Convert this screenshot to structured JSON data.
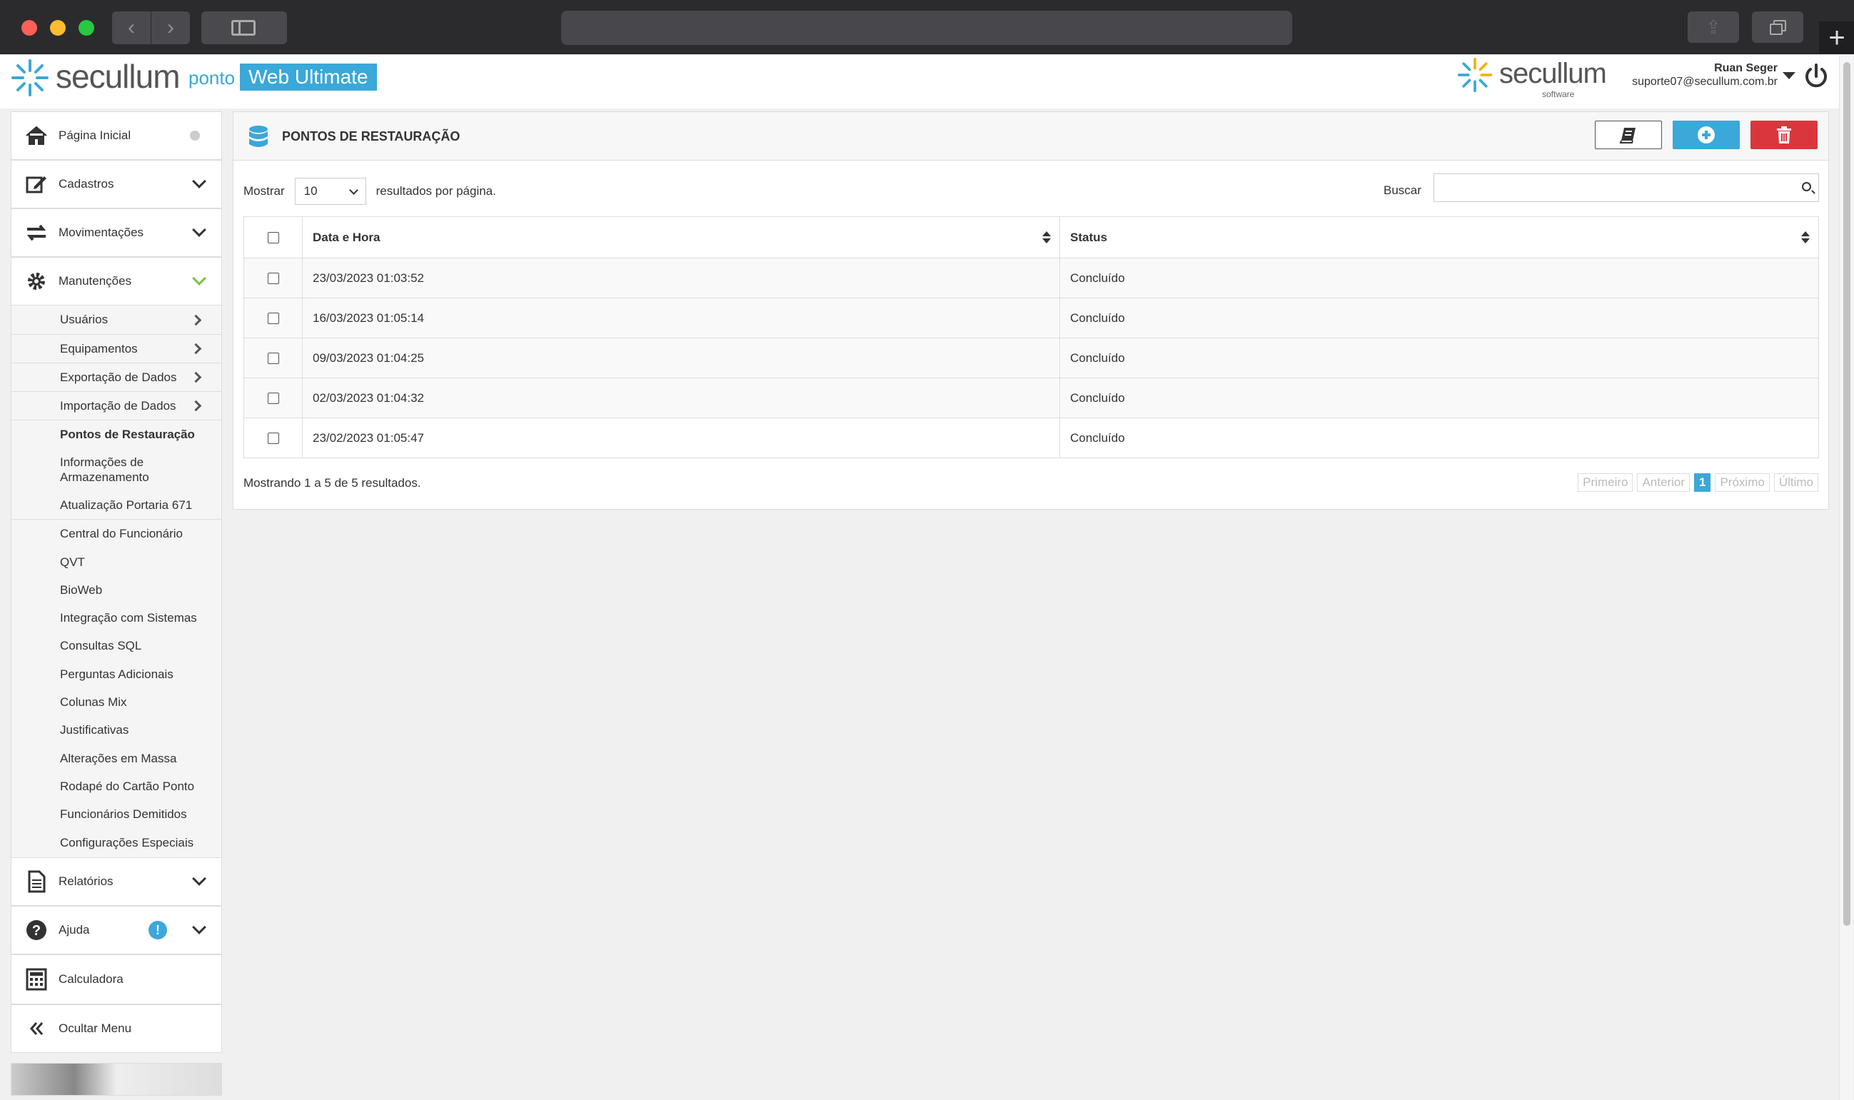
{
  "browser": {
    "newtab": "+"
  },
  "header": {
    "logo_text": "secullum",
    "logo_ponto": "ponto",
    "logo_badge": "Web Ultimate",
    "logo2_text": "secullum",
    "logo2_sub": "software",
    "user_name": "Ruan Seger",
    "user_email": "suporte07@secullum.com.br"
  },
  "sidebar": {
    "main": [
      {
        "label": "Página Inicial",
        "icon": "home-icon"
      },
      {
        "label": "Cadastros",
        "icon": "edit-icon"
      },
      {
        "label": "Movimentações",
        "icon": "exchange-icon"
      },
      {
        "label": "Manutenções",
        "icon": "gear-icon"
      }
    ],
    "sub_arrow": [
      {
        "label": "Usuários"
      },
      {
        "label": "Equipamentos"
      },
      {
        "label": "Exportação de Dados"
      },
      {
        "label": "Importação de Dados"
      }
    ],
    "sub_plain": [
      {
        "label": "Pontos de Restauração"
      },
      {
        "label": "Informações de Armazenamento"
      },
      {
        "label": "Atualização Portaria 671"
      },
      {
        "label": "Central do Funcionário"
      },
      {
        "label": "QVT"
      },
      {
        "label": "BioWeb"
      },
      {
        "label": "Integração com Sistemas"
      },
      {
        "label": "Consultas SQL"
      },
      {
        "label": "Perguntas Adicionais"
      },
      {
        "label": "Colunas Mix"
      },
      {
        "label": "Justificativas"
      },
      {
        "label": "Alterações em Massa"
      },
      {
        "label": "Rodapé do Cartão Ponto"
      },
      {
        "label": "Funcionários Demitidos"
      },
      {
        "label": "Configurações Especiais"
      }
    ],
    "bottom": [
      {
        "label": "Relatórios",
        "icon": "document-icon"
      },
      {
        "label": "Ajuda",
        "icon": "help-icon",
        "badge": "!"
      },
      {
        "label": "Calculadora",
        "icon": "calculator-icon"
      },
      {
        "label": "Ocultar Menu",
        "icon": "double-chevron-left-icon"
      }
    ]
  },
  "panel": {
    "title": "PONTOS DE RESTAURAÇÃO",
    "show_label": "Mostrar",
    "page_size": "10",
    "per_page_label": "resultados por página.",
    "search_label": "Buscar",
    "search_value": "",
    "columns": [
      "Data e Hora",
      "Status"
    ],
    "rows": [
      {
        "datetime": "23/03/2023 01:03:52",
        "status": "Concluído"
      },
      {
        "datetime": "16/03/2023 01:05:14",
        "status": "Concluído"
      },
      {
        "datetime": "09/03/2023 01:04:25",
        "status": "Concluído"
      },
      {
        "datetime": "02/03/2023 01:04:32",
        "status": "Concluído"
      },
      {
        "datetime": "23/02/2023 01:05:47",
        "status": "Concluído"
      }
    ],
    "info": "Mostrando 1 a 5 de 5 resultados.",
    "pager": {
      "first": "Primeiro",
      "prev": "Anterior",
      "current": "1",
      "next": "Próximo",
      "last": "Último"
    }
  },
  "colors": {
    "accent": "#3aa8d8",
    "danger": "#d9363e",
    "success": "#7ac143"
  }
}
